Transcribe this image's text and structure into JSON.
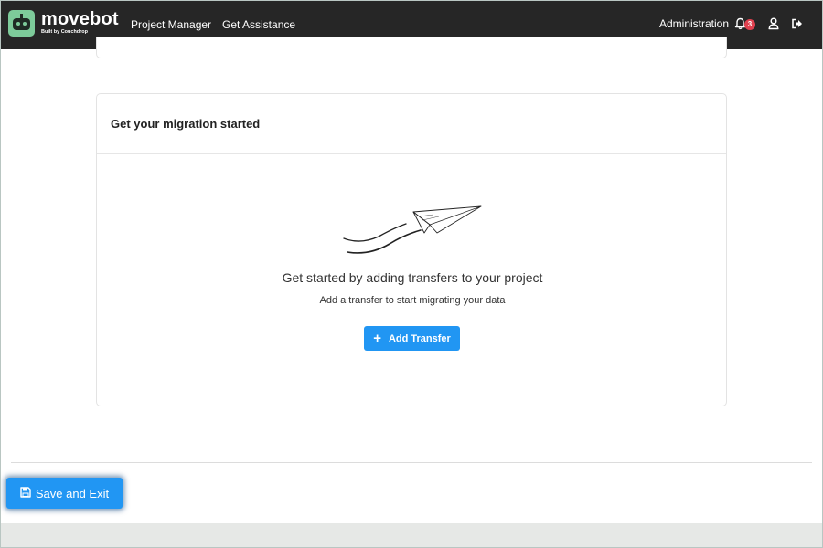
{
  "navbar": {
    "brand_name": "movebot",
    "brand_sub": "Built by Couchdrop",
    "links": [
      {
        "label": "Project Manager"
      },
      {
        "label": "Get Assistance"
      }
    ],
    "admin_label": "Administration",
    "notification_count": "3",
    "icons": [
      "bell-icon",
      "user-icon",
      "logout-icon"
    ]
  },
  "card": {
    "title": "Get your migration started",
    "empty_title": "Get started by adding transfers to your project",
    "empty_subtitle": "Add a transfer to start migrating your data",
    "add_button_label": "Add Transfer",
    "illustration": "paper-plane"
  },
  "footer": {
    "save_button_label": "Save and Exit",
    "save_icon": "floppy-disk-icon"
  },
  "colors": {
    "navbar_bg": "#262626",
    "brand_green": "#7dcb9a",
    "primary_blue": "#2196f3",
    "badge_red": "#e0414f"
  }
}
